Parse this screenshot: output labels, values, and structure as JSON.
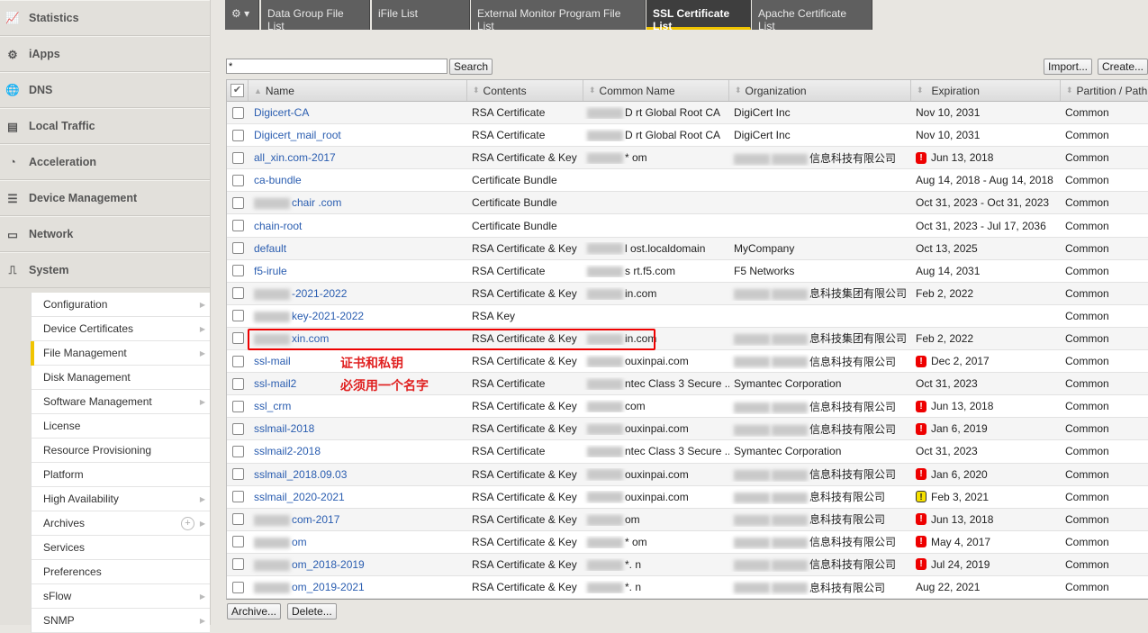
{
  "sidebar": {
    "main": [
      {
        "label": "Statistics",
        "icon": "statistics-icon"
      },
      {
        "label": "iApps",
        "icon": "iapps-icon"
      },
      {
        "label": "DNS",
        "icon": "globe-icon"
      },
      {
        "label": "Local Traffic",
        "icon": "servers-icon"
      },
      {
        "label": "Acceleration",
        "icon": "gauge-icon"
      },
      {
        "label": "Device Management",
        "icon": "device-icon"
      },
      {
        "label": "Network",
        "icon": "network-icon"
      },
      {
        "label": "System",
        "icon": "system-icon"
      }
    ],
    "submenu": [
      {
        "label": "Configuration",
        "arrow": true
      },
      {
        "label": "Device Certificates",
        "arrow": true
      },
      {
        "label": "File Management",
        "arrow": true,
        "active": true
      },
      {
        "label": "Disk Management"
      },
      {
        "label": "Software Management",
        "arrow": true
      },
      {
        "label": "License"
      },
      {
        "label": "Resource Provisioning"
      },
      {
        "label": "Platform"
      },
      {
        "label": "High Availability",
        "arrow": true
      },
      {
        "label": "Archives",
        "arrow": true,
        "plus": true
      },
      {
        "label": "Services"
      },
      {
        "label": "Preferences"
      },
      {
        "label": "sFlow",
        "arrow": true
      },
      {
        "label": "SNMP",
        "arrow": true
      }
    ]
  },
  "tabs": [
    "Data Group File List",
    "iFile List",
    "External Monitor Program File List",
    "SSL Certificate List",
    "Apache Certificate List"
  ],
  "active_tab": "SSL Certificate List",
  "search": {
    "value": "*",
    "button": "Search"
  },
  "buttons": {
    "import": "Import...",
    "create": "Create...",
    "archive": "Archive...",
    "delete": "Delete..."
  },
  "columns": [
    "Name",
    "Contents",
    "Common Name",
    "Organization",
    "Expiration",
    "Partition / Path"
  ],
  "rows": [
    {
      "name": "Digicert-CA",
      "contents": "RSA Certificate",
      "cn": "D  rt Global Root CA",
      "org": "DigiCert Inc",
      "exp": "Nov 10, 2031",
      "status": "",
      "part": "Common"
    },
    {
      "name": "Digicert_mail_root",
      "contents": "RSA Certificate",
      "cn": "D  rt Global Root CA",
      "org": "DigiCert Inc",
      "exp": "Nov 10, 2031",
      "status": "",
      "part": "Common"
    },
    {
      "name": "all_xin.com-2017",
      "contents": "RSA Certificate & Key",
      "cn": "*  om",
      "org": "信息科技有限公司",
      "exp": "Jun 13, 2018",
      "status": "error",
      "part": "Common"
    },
    {
      "name": "ca-bundle",
      "contents": "Certificate Bundle",
      "cn": "",
      "org": "",
      "exp": "Aug 14, 2018 - Aug 14, 2018",
      "status": "",
      "part": "Common"
    },
    {
      "name": "chair  .com",
      "contents": "Certificate Bundle",
      "cn": "",
      "org": "",
      "exp": "Oct 31, 2023 - Oct 31, 2023",
      "status": "",
      "part": "Common"
    },
    {
      "name": "chain-root",
      "contents": "Certificate Bundle",
      "cn": "",
      "org": "",
      "exp": "Oct 31, 2023 - Jul 17, 2036",
      "status": "",
      "part": "Common"
    },
    {
      "name": "default",
      "contents": "RSA Certificate & Key",
      "cn": "l  ost.localdomain",
      "org": "MyCompany",
      "exp": "Oct 13, 2025",
      "status": "",
      "part": "Common"
    },
    {
      "name": "f5-irule",
      "contents": "RSA Certificate",
      "cn": "s  rt.f5.com",
      "org": "F5 Networks",
      "exp": "Aug 14, 2031",
      "status": "",
      "part": "Common"
    },
    {
      "name": "-2021-2022",
      "contents": "RSA Certificate & Key",
      "cn": "in.com",
      "org": "息科技集团有限公司",
      "exp": "Feb 2, 2022",
      "status": "",
      "part": "Common"
    },
    {
      "name": "key-2021-2022",
      "contents": "RSA Key",
      "cn": "",
      "org": "",
      "exp": "",
      "status": "",
      "part": "Common"
    },
    {
      "name": "xin.com",
      "contents": "RSA Certificate & Key",
      "cn": "in.com",
      "org": "息科技集团有限公司",
      "exp": "Feb 2, 2022",
      "status": "",
      "part": "Common"
    },
    {
      "name": "ssl-mail",
      "contents": "RSA Certificate & Key",
      "cn": "ouxinpai.com",
      "org": "信息科技有限公司",
      "exp": "Dec 2, 2017",
      "status": "error",
      "part": "Common"
    },
    {
      "name": "ssl-mail2",
      "contents": "RSA Certificate",
      "cn": "ntec Class 3 Secure ...",
      "org": "Symantec Corporation",
      "exp": "Oct 31, 2023",
      "status": "",
      "part": "Common"
    },
    {
      "name": "ssl_crm",
      "contents": "RSA Certificate & Key",
      "cn": "com",
      "org": "信息科技有限公司",
      "exp": "Jun 13, 2018",
      "status": "error",
      "part": "Common"
    },
    {
      "name": "sslmail-2018",
      "contents": "RSA Certificate & Key",
      "cn": "ouxinpai.com",
      "org": "信息科技有限公司",
      "exp": "Jan 6, 2019",
      "status": "error",
      "part": "Common"
    },
    {
      "name": "sslmail2-2018",
      "contents": "RSA Certificate",
      "cn": "ntec Class 3 Secure ...",
      "org": "Symantec Corporation",
      "exp": "Oct 31, 2023",
      "status": "",
      "part": "Common"
    },
    {
      "name": "sslmail_2018.09.03",
      "contents": "RSA Certificate & Key",
      "cn": "ouxinpai.com",
      "org": "信息科技有限公司",
      "exp": "Jan 6, 2020",
      "status": "error",
      "part": "Common"
    },
    {
      "name": "sslmail_2020-2021",
      "contents": "RSA Certificate & Key",
      "cn": "ouxinpai.com",
      "org": "息科技有限公司",
      "exp": "Feb 3, 2021",
      "status": "warning",
      "part": "Common"
    },
    {
      "name": "com-2017",
      "contents": "RSA Certificate & Key",
      "cn": "om",
      "org": "息科技有限公司",
      "exp": "Jun 13, 2018",
      "status": "error",
      "part": "Common"
    },
    {
      "name": "om",
      "contents": "RSA Certificate & Key",
      "cn": "*  om",
      "org": "信息科技有限公司",
      "exp": "May 4, 2017",
      "status": "error",
      "part": "Common"
    },
    {
      "name": "om_2018-2019",
      "contents": "RSA Certificate & Key",
      "cn": "*.  n",
      "org": "信息科技有限公司",
      "exp": "Jul 24, 2019",
      "status": "error",
      "part": "Common"
    },
    {
      "name": "om_2019-2021",
      "contents": "RSA Certificate & Key",
      "cn": "*.  n",
      "org": "息科技有限公司",
      "exp": "Aug 22, 2021",
      "status": "",
      "part": "Common"
    }
  ],
  "annotation": {
    "line1": "证书和私钥",
    "line2": "必须用一个名字",
    "color": "#e02020"
  },
  "colors": {
    "accent": "#f0c400",
    "link": "#2a5db0",
    "error": "#ee0000",
    "warning": "#f5e000"
  }
}
